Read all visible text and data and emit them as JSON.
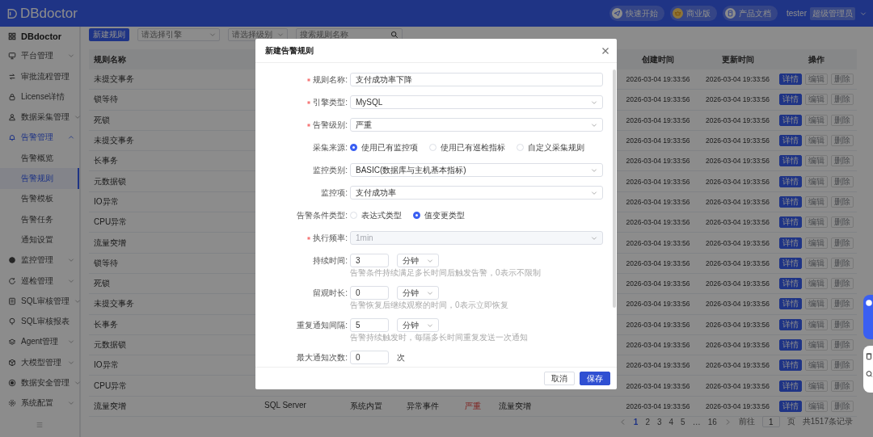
{
  "header": {
    "logo": "DBdoctor",
    "links": [
      {
        "label": "快速开始",
        "kind": "quickstart"
      },
      {
        "label": "商业版",
        "kind": "commercial"
      },
      {
        "label": "产品文档",
        "kind": "docs"
      }
    ],
    "user": "tester",
    "role": "超级管理员"
  },
  "sidebar": {
    "title": "DBdoctor",
    "items": [
      {
        "label": "平台管理",
        "kind": "group",
        "expanded": false,
        "selected": false
      },
      {
        "label": "审批流程管理",
        "kind": "link",
        "selected": false
      },
      {
        "label": "License详情",
        "kind": "link",
        "selected": false
      },
      {
        "label": "数据采集管理",
        "kind": "group",
        "expanded": false,
        "selected": false
      },
      {
        "label": "告警管理",
        "kind": "group",
        "expanded": true,
        "selected": true,
        "children": [
          {
            "label": "告警概览",
            "selected": false
          },
          {
            "label": "告警规则",
            "selected": true
          },
          {
            "label": "告警模板",
            "selected": false
          },
          {
            "label": "告警任务",
            "selected": false
          },
          {
            "label": "通知设置",
            "selected": false
          }
        ]
      },
      {
        "label": "监控管理",
        "kind": "group",
        "expanded": false,
        "selected": false
      },
      {
        "label": "巡检管理",
        "kind": "group",
        "expanded": false,
        "selected": false
      },
      {
        "label": "SQL审核管理",
        "kind": "group",
        "expanded": false,
        "selected": false
      },
      {
        "label": "SQL审核报表",
        "kind": "link",
        "selected": false
      },
      {
        "label": "Agent管理",
        "kind": "group",
        "expanded": false,
        "selected": false
      },
      {
        "label": "大模型管理",
        "kind": "group",
        "expanded": false,
        "selected": false
      },
      {
        "label": "数据安全管理",
        "kind": "group",
        "expanded": false,
        "selected": false
      },
      {
        "label": "系统配置",
        "kind": "group",
        "expanded": false,
        "selected": false
      }
    ]
  },
  "toolbar": {
    "new_button": "新建规则",
    "filters": [
      {
        "kind": "select",
        "placeholder": "请选择引擎"
      },
      {
        "kind": "select",
        "placeholder": "请选择级别"
      },
      {
        "kind": "search",
        "placeholder": "搜索规则名称"
      }
    ]
  },
  "table": {
    "columns": [
      "规则名称",
      "创建时间",
      "更新时间",
      "操作"
    ],
    "rows": [
      {
        "name": "未提交事务",
        "created": "2026-03-04 19:33:56",
        "updated": "2026-03-04 19:33:56",
        "actions": [
          {
            "label": "详情",
            "disabled": false
          },
          {
            "label": "编辑",
            "disabled": true
          },
          {
            "label": "删除",
            "disabled": true
          }
        ]
      },
      {
        "name": "锁等待",
        "created": "2026-03-04 19:33:56",
        "updated": "2026-03-04 19:33:56",
        "actions": [
          {
            "label": "详情",
            "disabled": false
          },
          {
            "label": "编辑",
            "disabled": true
          },
          {
            "label": "删除",
            "disabled": true
          }
        ]
      },
      {
        "name": "死锁",
        "created": "2026-03-04 19:33:56",
        "updated": "2026-03-04 19:33:56",
        "actions": [
          {
            "label": "详情",
            "disabled": false
          },
          {
            "label": "编辑",
            "disabled": true
          },
          {
            "label": "删除",
            "disabled": true
          }
        ]
      },
      {
        "name": "未提交事务",
        "created": "2026-03-04 19:33:56",
        "updated": "2026-03-04 19:33:56",
        "actions": [
          {
            "label": "详情",
            "disabled": false
          },
          {
            "label": "编辑",
            "disabled": true
          },
          {
            "label": "删除",
            "disabled": true
          }
        ]
      },
      {
        "name": "长事务",
        "created": "2026-03-04 19:33:56",
        "updated": "2026-03-04 19:33:56",
        "actions": [
          {
            "label": "详情",
            "disabled": false
          },
          {
            "label": "编辑",
            "disabled": true
          },
          {
            "label": "删除",
            "disabled": true
          }
        ]
      },
      {
        "name": "元数据锁",
        "created": "2026-03-04 19:33:56",
        "updated": "2026-03-04 19:33:56",
        "actions": [
          {
            "label": "详情",
            "disabled": false
          },
          {
            "label": "编辑",
            "disabled": true
          },
          {
            "label": "删除",
            "disabled": true
          }
        ]
      },
      {
        "name": "IO异常",
        "created": "2026-03-04 19:33:56",
        "updated": "2026-03-04 19:33:56",
        "actions": [
          {
            "label": "详情",
            "disabled": false
          },
          {
            "label": "编辑",
            "disabled": true
          },
          {
            "label": "删除",
            "disabled": true
          }
        ]
      },
      {
        "name": "CPU异常",
        "created": "2026-03-04 19:33:56",
        "updated": "2026-03-04 19:33:56",
        "actions": [
          {
            "label": "详情",
            "disabled": false
          },
          {
            "label": "编辑",
            "disabled": true
          },
          {
            "label": "删除",
            "disabled": true
          }
        ]
      },
      {
        "name": "流量突增",
        "created": "2026-03-04 19:33:56",
        "updated": "2026-03-04 19:33:56",
        "actions": [
          {
            "label": "详情",
            "disabled": false
          },
          {
            "label": "编辑",
            "disabled": true
          },
          {
            "label": "删除",
            "disabled": true
          }
        ]
      },
      {
        "name": "锁等待",
        "created": "2026-03-04 19:33:56",
        "updated": "2026-03-04 19:33:56",
        "actions": [
          {
            "label": "详情",
            "disabled": false
          },
          {
            "label": "编辑",
            "disabled": true
          },
          {
            "label": "删除",
            "disabled": true
          }
        ]
      },
      {
        "name": "死锁",
        "created": "2026-03-04 19:33:56",
        "updated": "2026-03-04 19:33:56",
        "actions": [
          {
            "label": "详情",
            "disabled": false
          },
          {
            "label": "编辑",
            "disabled": true
          },
          {
            "label": "删除",
            "disabled": true
          }
        ]
      },
      {
        "name": "未提交事务",
        "created": "2026-03-04 19:33:56",
        "updated": "2026-03-04 19:33:56",
        "actions": [
          {
            "label": "详情",
            "disabled": false
          },
          {
            "label": "编辑",
            "disabled": true
          },
          {
            "label": "删除",
            "disabled": true
          }
        ]
      },
      {
        "name": "长事务",
        "created": "2026-03-04 19:33:56",
        "updated": "2026-03-04 19:33:56",
        "actions": [
          {
            "label": "详情",
            "disabled": false
          },
          {
            "label": "编辑",
            "disabled": true
          },
          {
            "label": "删除",
            "disabled": true
          }
        ]
      },
      {
        "name": "元数据锁",
        "created": "2026-03-04 19:33:56",
        "updated": "2026-03-04 19:33:56",
        "actions": [
          {
            "label": "详情",
            "disabled": false
          },
          {
            "label": "编辑",
            "disabled": true
          },
          {
            "label": "删除",
            "disabled": true
          }
        ]
      },
      {
        "name": "IO异常",
        "created": "2026-03-04 19:33:56",
        "updated": "2026-03-04 19:33:56",
        "actions": [
          {
            "label": "详情",
            "disabled": false
          },
          {
            "label": "编辑",
            "disabled": true
          },
          {
            "label": "删除",
            "disabled": true
          }
        ]
      },
      {
        "name": "CPU异常",
        "created": "2026-03-04 19:33:56",
        "updated": "2026-03-04 19:33:56",
        "actions": [
          {
            "label": "详情",
            "disabled": false
          },
          {
            "label": "编辑",
            "disabled": true
          },
          {
            "label": "删除",
            "disabled": true
          }
        ]
      },
      {
        "name": "流量突增",
        "extra": [
          {
            "text": "SQL Server",
            "kind": "text"
          },
          {
            "text": "系统内置",
            "kind": "text"
          },
          {
            "text": "异常事件",
            "kind": "text"
          },
          {
            "text": "严重",
            "kind": "severity"
          },
          {
            "text": "流量突增",
            "kind": "text"
          }
        ],
        "created": "2026-03-04 19:33:56",
        "updated": "2026-03-04 19:33:56",
        "actions": [
          {
            "label": "详情",
            "disabled": false
          },
          {
            "label": "编辑",
            "disabled": true
          },
          {
            "label": "删除",
            "disabled": true
          }
        ]
      }
    ]
  },
  "pagination": {
    "pages": [
      {
        "label": "1",
        "selected": true
      },
      {
        "label": "2",
        "selected": false
      },
      {
        "label": "3",
        "selected": false
      },
      {
        "label": "4",
        "selected": false
      },
      {
        "label": "5",
        "selected": false
      },
      {
        "label": "…",
        "selected": false
      },
      {
        "label": "16",
        "selected": false
      }
    ],
    "goto_label": "前往",
    "goto_value": "1",
    "page_unit": "页",
    "total": "共1517条记录"
  },
  "modal": {
    "title": "新建告警规则",
    "fields": [
      {
        "label": "规则名称:",
        "required": true,
        "kind": "input",
        "value": "支付成功率下降"
      },
      {
        "label": "引擎类型:",
        "required": true,
        "kind": "select",
        "value": "MySQL",
        "disabled": false
      },
      {
        "label": "告警级别:",
        "required": true,
        "kind": "select",
        "value": "严重",
        "disabled": false
      },
      {
        "label": "采集来源:",
        "required": false,
        "kind": "radio",
        "options": [
          {
            "label": "使用已有监控项",
            "selected": true
          },
          {
            "label": "使用已有巡检指标",
            "selected": false
          },
          {
            "label": "自定义采集规则",
            "selected": false
          }
        ]
      },
      {
        "label": "监控类别:",
        "required": false,
        "kind": "select",
        "value": "BASIC(数据库与主机基本指标)",
        "disabled": false
      },
      {
        "label": "监控项:",
        "required": false,
        "kind": "select",
        "value": "支付成功率",
        "disabled": false
      },
      {
        "label": "告警条件类型:",
        "required": false,
        "kind": "radio",
        "options": [
          {
            "label": "表达式类型",
            "selected": false
          },
          {
            "label": "值变更类型",
            "selected": true
          }
        ]
      },
      {
        "label": "执行频率:",
        "required": true,
        "kind": "select",
        "value": "1min",
        "disabled": true
      },
      {
        "label": "持续时间:",
        "required": false,
        "kind": "duration",
        "value": "3",
        "unit": "分钟",
        "hint": "告警条件持续满足多长时间后触发告警，0表示不限制"
      },
      {
        "label": "留观时长:",
        "required": false,
        "kind": "duration",
        "value": "0",
        "unit": "分钟",
        "hint": "告警恢复后继续观察的时间，0表示立即恢复"
      },
      {
        "label": "重复通知间隔:",
        "required": false,
        "kind": "duration",
        "value": "5",
        "unit": "分钟",
        "hint": "告警持续触发时，每隔多长时间重复发送一次通知"
      },
      {
        "label": "最大通知次数:",
        "required": false,
        "kind": "count",
        "value": "0",
        "unit": "次"
      }
    ],
    "buttons": [
      {
        "label": "取消",
        "kind": "default"
      },
      {
        "label": "保存",
        "kind": "primary"
      }
    ]
  }
}
